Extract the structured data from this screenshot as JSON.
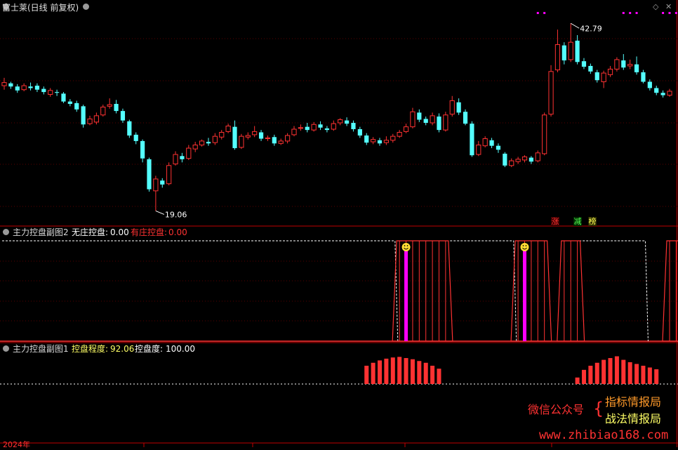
{
  "header": {
    "title": "富士莱(日线 前复权)",
    "sub2_name": "主力控盘副图2",
    "sub2_l1": "无庄控盘:",
    "sub2_v1": "0.00",
    "sub2_l2": "有庄控盘:",
    "sub2_v2": "0.00",
    "sub1_name": "主力控盘副图1",
    "sub1_l1": "控盘程度:",
    "sub1_v1": "92.06",
    "sub1_l2": "控盘度:",
    "sub1_v2": "100.00"
  },
  "markers": {
    "zhang": "涨",
    "jian": "减",
    "bang": "榜"
  },
  "watermark": {
    "left": "微信公众号",
    "right1": "指标情报局",
    "right2": "战法情报局",
    "url": "www.zhibiao168.com"
  },
  "date_label": "2024年",
  "colors": {
    "up": "#ff3232",
    "down": "#54ffff",
    "magenta": "#ff00ff",
    "frame": "#c00000",
    "white": "#ffffff"
  },
  "chart_data": {
    "type": "candlestick",
    "y_range": [
      17.5,
      44.5
    ],
    "high_label": "42.79",
    "low_label": "19.06",
    "candles": [
      [
        34.9,
        35.3,
        35.9,
        34.4
      ],
      [
        35.2,
        34.8,
        35.4,
        34.5
      ],
      [
        34.8,
        34.3,
        35.1,
        34.0
      ],
      [
        34.4,
        34.9,
        35.2,
        34.2
      ],
      [
        34.8,
        34.6,
        35.3,
        34.3
      ],
      [
        34.9,
        34.4,
        35.2,
        34.1
      ],
      [
        34.5,
        34.1,
        34.8,
        33.8
      ],
      [
        33.8,
        34.3,
        34.6,
        33.5
      ],
      [
        34.1,
        34.0,
        34.4,
        33.6
      ],
      [
        33.9,
        32.9,
        34.1,
        32.7
      ],
      [
        32.9,
        32.6,
        33.2,
        32.3
      ],
      [
        32.7,
        31.9,
        33.0,
        31.6
      ],
      [
        32.3,
        30.0,
        32.5,
        29.6
      ],
      [
        30.1,
        30.7,
        31.1,
        29.9
      ],
      [
        30.3,
        31.1,
        31.5,
        30.0
      ],
      [
        31.2,
        32.2,
        32.5,
        31.0
      ],
      [
        32.3,
        32.5,
        33.3,
        32.0
      ],
      [
        32.6,
        31.7,
        33.1,
        31.4
      ],
      [
        31.7,
        30.5,
        32.0,
        30.2
      ],
      [
        30.4,
        28.6,
        30.6,
        28.3
      ],
      [
        28.7,
        27.9,
        29.0,
        27.5
      ],
      [
        27.9,
        25.7,
        28.1,
        25.2
      ],
      [
        25.6,
        21.8,
        25.8,
        21.5
      ],
      [
        21.6,
        23.1,
        23.5,
        19.06
      ],
      [
        22.9,
        22.4,
        23.2,
        22.0
      ],
      [
        22.5,
        24.8,
        25.2,
        22.3
      ],
      [
        25.0,
        26.2,
        26.6,
        24.8
      ],
      [
        26.0,
        25.6,
        26.4,
        25.2
      ],
      [
        25.7,
        27.0,
        27.4,
        25.5
      ],
      [
        26.9,
        27.4,
        27.8,
        26.5
      ],
      [
        27.4,
        27.9,
        28.1,
        27.2
      ],
      [
        27.8,
        27.6,
        28.3,
        27.3
      ],
      [
        27.7,
        28.5,
        28.9,
        27.4
      ],
      [
        28.4,
        29.0,
        29.3,
        28.1
      ],
      [
        29.1,
        29.8,
        30.1,
        28.9
      ],
      [
        29.7,
        27.0,
        30.5,
        26.8
      ],
      [
        27.1,
        28.5,
        28.8,
        26.9
      ],
      [
        28.4,
        28.6,
        29.0,
        28.1
      ],
      [
        28.7,
        29.1,
        29.8,
        28.4
      ],
      [
        29.0,
        28.2,
        29.3,
        27.9
      ],
      [
        28.2,
        28.3,
        28.6,
        27.9
      ],
      [
        28.4,
        27.6,
        28.7,
        27.3
      ],
      [
        27.6,
        27.9,
        28.2,
        27.4
      ],
      [
        27.9,
        28.6,
        28.9,
        27.6
      ],
      [
        28.7,
        29.4,
        29.8,
        28.5
      ],
      [
        29.5,
        29.6,
        30.0,
        29.2
      ],
      [
        29.7,
        29.3,
        30.2,
        29.0
      ],
      [
        29.3,
        30.0,
        30.3,
        29.1
      ],
      [
        30.0,
        29.6,
        30.4,
        29.3
      ],
      [
        29.5,
        29.3,
        29.8,
        29.0
      ],
      [
        29.4,
        30.1,
        30.5,
        29.2
      ],
      [
        30.2,
        30.6,
        30.8,
        29.9
      ],
      [
        30.5,
        30.1,
        30.9,
        29.8
      ],
      [
        30.2,
        29.4,
        30.5,
        29.1
      ],
      [
        29.4,
        28.6,
        29.7,
        28.3
      ],
      [
        28.6,
        27.7,
        28.9,
        27.4
      ],
      [
        27.8,
        28.1,
        28.4,
        27.5
      ],
      [
        28.0,
        27.6,
        28.3,
        27.3
      ],
      [
        27.7,
        28.0,
        28.5,
        27.4
      ],
      [
        28.0,
        28.5,
        28.8,
        27.7
      ],
      [
        28.5,
        29.0,
        29.3,
        28.3
      ],
      [
        29.1,
        29.7,
        30.1,
        28.9
      ],
      [
        29.7,
        31.6,
        32.1,
        29.5
      ],
      [
        31.5,
        30.6,
        31.9,
        30.3
      ],
      [
        30.7,
        30.2,
        31.0,
        29.9
      ],
      [
        30.2,
        31.1,
        31.5,
        29.9
      ],
      [
        31.0,
        29.3,
        31.4,
        29.0
      ],
      [
        29.3,
        31.2,
        31.6,
        29.1
      ],
      [
        31.3,
        33.0,
        33.6,
        31.0
      ],
      [
        32.8,
        31.5,
        33.3,
        31.2
      ],
      [
        31.6,
        30.1,
        31.9,
        29.9
      ],
      [
        30.1,
        26.1,
        30.4,
        25.9
      ],
      [
        26.2,
        27.4,
        27.9,
        26.0
      ],
      [
        27.3,
        28.2,
        28.5,
        27.1
      ],
      [
        28.0,
        27.3,
        28.3,
        27.0
      ],
      [
        27.3,
        26.8,
        27.6,
        26.4
      ],
      [
        26.3,
        24.8,
        26.5,
        24.6
      ],
      [
        24.8,
        25.4,
        25.7,
        24.6
      ],
      [
        25.3,
        25.6,
        25.9,
        25.0
      ],
      [
        25.5,
        25.9,
        26.1,
        25.2
      ],
      [
        25.8,
        25.3,
        26.0,
        25.0
      ],
      [
        25.4,
        26.4,
        26.7,
        25.2
      ],
      [
        26.3,
        31.2,
        31.5,
        26.1
      ],
      [
        31.3,
        36.7,
        37.5,
        31.0
      ],
      [
        36.9,
        40.1,
        42.0,
        36.6
      ],
      [
        40.0,
        38.1,
        40.4,
        37.6
      ],
      [
        38.2,
        40.4,
        42.79,
        37.9
      ],
      [
        40.6,
        37.9,
        41.3,
        37.6
      ],
      [
        38.0,
        37.3,
        38.4,
        37.0
      ],
      [
        37.4,
        36.7,
        37.7,
        36.4
      ],
      [
        36.6,
        35.6,
        36.9,
        35.3
      ],
      [
        35.4,
        36.5,
        36.8,
        34.6
      ],
      [
        36.3,
        37.0,
        37.4,
        36.0
      ],
      [
        37.0,
        38.2,
        38.5,
        36.7
      ],
      [
        38.1,
        37.2,
        38.9,
        36.9
      ],
      [
        37.4,
        37.6,
        38.2,
        37.0
      ],
      [
        37.6,
        36.6,
        38.6,
        36.3
      ],
      [
        36.6,
        35.4,
        36.9,
        35.2
      ],
      [
        35.4,
        34.6,
        35.7,
        34.3
      ],
      [
        34.6,
        34.0,
        34.9,
        33.7
      ],
      [
        34.0,
        33.7,
        34.3,
        33.4
      ],
      [
        33.7,
        34.2,
        34.5,
        33.5
      ]
    ],
    "kp_level": [
      0,
      0,
      0,
      0,
      0,
      0,
      0,
      0,
      0,
      0,
      0,
      0,
      0,
      0,
      0,
      0,
      0,
      0,
      0,
      0,
      0,
      0,
      0,
      0,
      0,
      0,
      0,
      0,
      0,
      0,
      0,
      0,
      0,
      0,
      0,
      0,
      0,
      0,
      0,
      0,
      0,
      0,
      0,
      0,
      0,
      0,
      0,
      0,
      0,
      0,
      0,
      0,
      0,
      0,
      0,
      62,
      72,
      80,
      86,
      90,
      92,
      88,
      84,
      78,
      72,
      62,
      52,
      0,
      0,
      0,
      0,
      0,
      0,
      0,
      0,
      0,
      0,
      0,
      0,
      0,
      0,
      0,
      0,
      0,
      0,
      0,
      0,
      22,
      48,
      62,
      72,
      82,
      88,
      94,
      82,
      74,
      68,
      62,
      56,
      50,
      0,
      0,
      0
    ],
    "kp_baseline": 11.0,
    "kp2_active": [
      0,
      0,
      0,
      0,
      0,
      0,
      0,
      0,
      0,
      0,
      0,
      0,
      0,
      0,
      0,
      0,
      0,
      0,
      0,
      0,
      0,
      0,
      0,
      0,
      0,
      0,
      0,
      0,
      0,
      0,
      0,
      0,
      0,
      0,
      0,
      0,
      0,
      0,
      0,
      0,
      0,
      0,
      0,
      0,
      0,
      0,
      0,
      0,
      0,
      0,
      0,
      0,
      0,
      0,
      0,
      0,
      0,
      0,
      0,
      0,
      1,
      1,
      1,
      1,
      1,
      1,
      1,
      1,
      0,
      0,
      0,
      0,
      0,
      0,
      0,
      0,
      0,
      0,
      1,
      1,
      1,
      1,
      1,
      0,
      0,
      1,
      1,
      1,
      0,
      0,
      0,
      0,
      0,
      0,
      0,
      0,
      0,
      0,
      0,
      0,
      0,
      1,
      1,
      1,
      1,
      0,
      0,
      0
    ],
    "top_dots": [
      81,
      82,
      94,
      95,
      96,
      100,
      101,
      102,
      103,
      104,
      105,
      106,
      107,
      108,
      112
    ]
  }
}
